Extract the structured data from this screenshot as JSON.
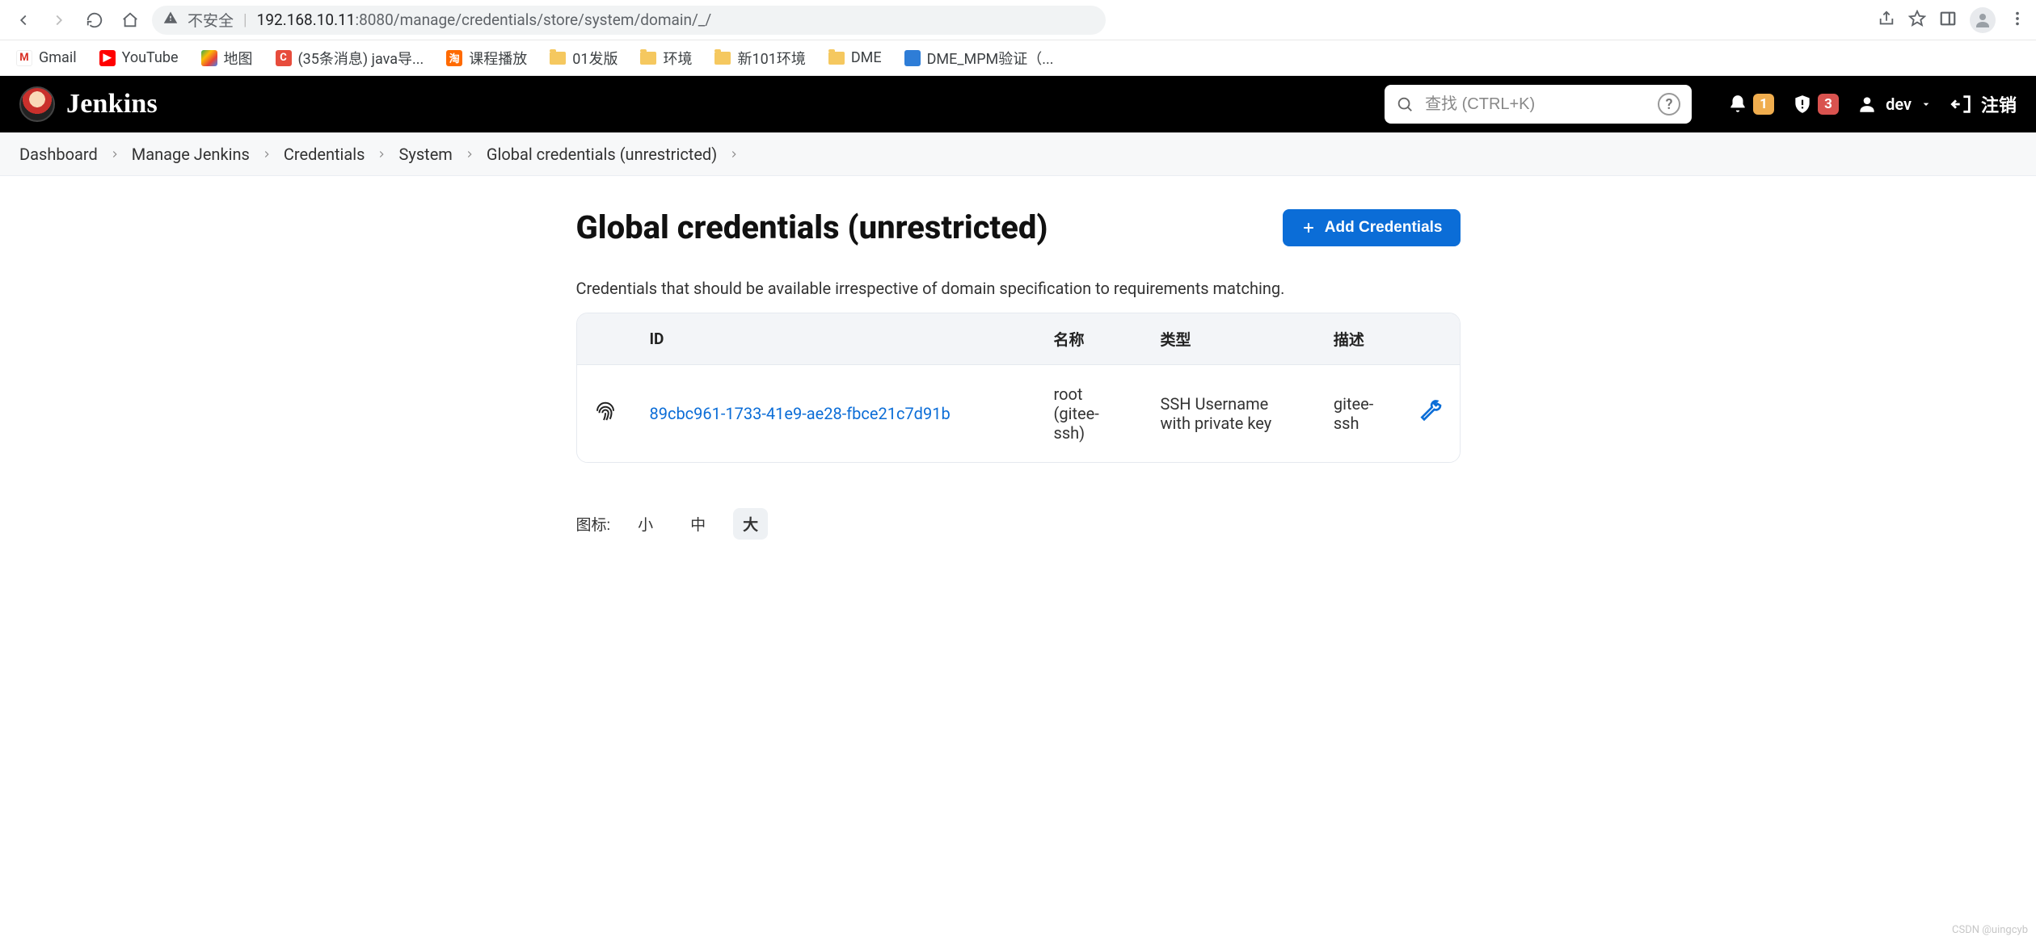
{
  "chrome": {
    "insecure_label": "不安全",
    "url_display_prefix": "192.168.10.11",
    "url_display_suffix": ":8080/manage/credentials/store/system/domain/_/"
  },
  "bookmarks": [
    {
      "label": "Gmail",
      "icon": "gmail"
    },
    {
      "label": "YouTube",
      "icon": "youtube"
    },
    {
      "label": "地图",
      "icon": "maps"
    },
    {
      "label": "(35条消息) java导...",
      "icon": "csdn"
    },
    {
      "label": "课程播放",
      "icon": "taobao"
    },
    {
      "label": "01发版",
      "icon": "folder"
    },
    {
      "label": "环境",
      "icon": "folder"
    },
    {
      "label": "新101环境",
      "icon": "folder"
    },
    {
      "label": "DME",
      "icon": "folder"
    },
    {
      "label": "DME_MPM验证（...",
      "icon": "blue"
    }
  ],
  "header": {
    "brand": "Jenkins",
    "search_placeholder": "查找 (CTRL+K)",
    "notif_count": "1",
    "alert_count": "3",
    "username": "dev",
    "logout_label": "注销"
  },
  "breadcrumb": [
    "Dashboard",
    "Manage Jenkins",
    "Credentials",
    "System",
    "Global credentials (unrestricted)"
  ],
  "page": {
    "title": "Global credentials (unrestricted)",
    "add_label": "Add Credentials",
    "description": "Credentials that should be available irrespective of domain specification to requirements matching."
  },
  "table": {
    "columns": {
      "id": "ID",
      "name": "名称",
      "type": "类型",
      "desc": "描述"
    },
    "rows": [
      {
        "id": "89cbc961-1733-41e9-ae28-fbce21c7d91b",
        "name": "root (gitee-ssh)",
        "type": "SSH Username with private key",
        "desc": "gitee-ssh"
      }
    ]
  },
  "iconsize": {
    "label": "图标:",
    "options": [
      "小",
      "中",
      "大"
    ],
    "active_index": 2
  },
  "watermark": "CSDN @uingcyb"
}
